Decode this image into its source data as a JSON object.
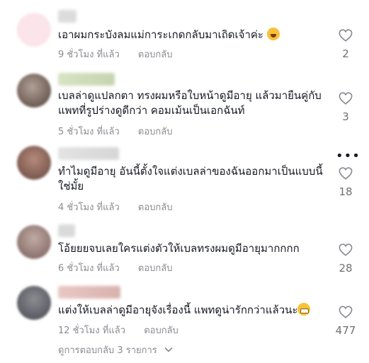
{
  "comments": [
    {
      "text": "เอาผมกระบังลมแม่การะเกดกลับมาเถิดเจ้าค่ะ",
      "emoji": "laughing-emoji",
      "time": "9 ชั่วโมง ที่แล้ว",
      "reply": "ตอบกลับ",
      "likes": "2"
    },
    {
      "text": "เบลล่าดูแปลกตา ทรงผมหรือใบหน้าดูมีอายุ แล้วมายืนคู่กับแพทที่รูปร่างดูดีกว่า คอมเม้นเป็นเอกฉันท์",
      "time": "5 ชั่วโมง ที่แล้ว",
      "reply": "ตอบกลับ",
      "likes": "3"
    },
    {
      "text": "ทำไมดูมีอายุ อันนี้ตั้งใจแต่งเบลล่าของฉันออกมาเป็นแบบนี้ใช่มั้ย",
      "time": "4 ชั่วโมง ที่แล้ว",
      "reply": "ตอบกลับ",
      "likes": "18"
    },
    {
      "text": "โอ้ยยยจบเลยใครแต่งตัวให้เบลทรงผมดูมีอายุมากกกก",
      "time": "6 ชั่วโมง ที่แล้ว",
      "reply": "ตอบกลับ",
      "likes": "28"
    },
    {
      "text": "แต่งให้เบลล่าดูมีอายุจังเรื่องนี้ แพทดูน่ารักกว่าแล้วนะ",
      "emoji": "grinning-emoji",
      "time": "12 ชั่วโมง ที่แล้ว",
      "reply": "ตอบกลับ",
      "likes": "477"
    }
  ],
  "more_options": "•••",
  "view_replies": "ดูการตอบกลับ 3 รายการ",
  "icons": {
    "like": "heart-outline-icon",
    "expand": "chevron-down-icon"
  },
  "colors": {
    "text": "#161823",
    "meta": "#8a8b91",
    "like_count": "#707070"
  }
}
